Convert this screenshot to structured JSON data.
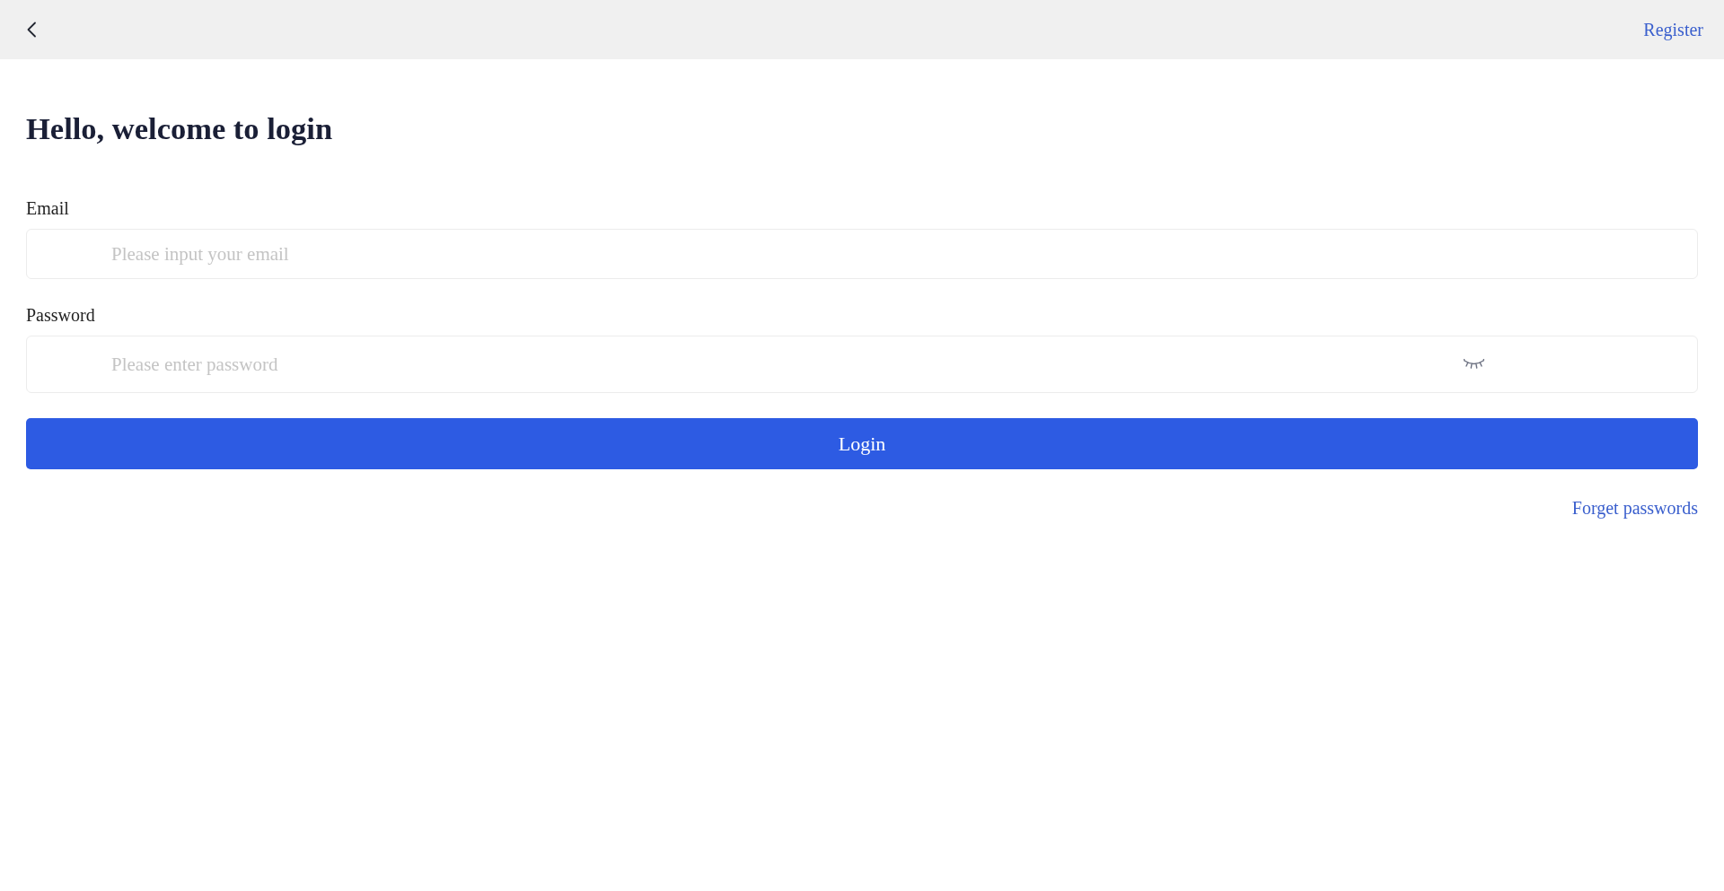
{
  "header": {
    "register_link": "Register"
  },
  "title": "Hello, welcome to login",
  "fields": [
    {
      "kind": "email",
      "label": "Email",
      "placeholder": "Please input your email"
    },
    {
      "kind": "password",
      "label": "Password",
      "placeholder": "Please enter password"
    }
  ],
  "login_button": "Login",
  "forgot_link": "Forget passwords"
}
